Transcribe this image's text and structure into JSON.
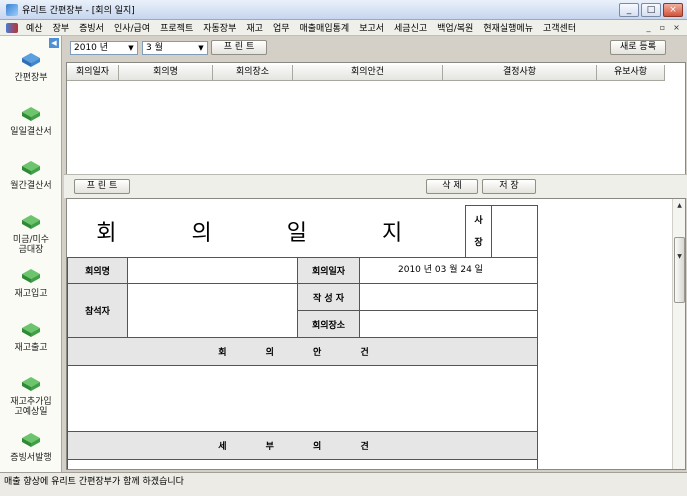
{
  "window": {
    "title": "유리트 간편장부 - [회의 일지]",
    "minimize": "_",
    "maximize": "□",
    "close": "×"
  },
  "menu": {
    "items": [
      "예산",
      "장부",
      "증빙서",
      "인사/급여",
      "프로젝트",
      "자동장부",
      "재고",
      "업무",
      "매출매입통계",
      "보고서",
      "세금신고",
      "백업/복원",
      "현재실행메뉴",
      "고객센터"
    ],
    "mdi_min": "_",
    "mdi_restore": "▫",
    "mdi_close": "×"
  },
  "sidebar": {
    "collapse": "◀",
    "items": [
      {
        "label": "간편장부",
        "color": "#3a8fd0"
      },
      {
        "label": "일일결산서",
        "color": "#3aa040"
      },
      {
        "label": "월간결산서",
        "color": "#3aa040"
      },
      {
        "label": "미금/미수금대장",
        "color": "#3aa040"
      },
      {
        "label": "재고입고",
        "color": "#3aa040"
      },
      {
        "label": "재고출고",
        "color": "#3aa040"
      },
      {
        "label": "재고추가입고예상일",
        "color": "#3aa040"
      },
      {
        "label": "증빙서발행",
        "color": "#3aa040"
      }
    ]
  },
  "toolbar": {
    "year": "2010 년",
    "month": "3 월",
    "print_top": "프 린 트",
    "new": "새로 등록",
    "print_bottom": "프 린 트",
    "delete": "삭 제",
    "save": "저 장"
  },
  "grid": {
    "columns": [
      "회의일자",
      "회의명",
      "회의장소",
      "회의안건",
      "결정사항",
      "유보사항"
    ]
  },
  "form": {
    "title": "회 의 일 지",
    "sign_label_1": "사",
    "sign_label_2": "장",
    "meeting_name_label": "회의명",
    "meeting_date_label": "회의일자",
    "meeting_date_value": "2010 년  03 월  24 일",
    "attendees_label": "참석자",
    "author_label": "작 성 자",
    "place_label": "회의장소",
    "agenda_label": "회 의 안 건",
    "details_label": "세 부 의 견"
  },
  "status": {
    "text": "매출 향상에 유리트 간편장부가 함께 하겠습니다"
  }
}
